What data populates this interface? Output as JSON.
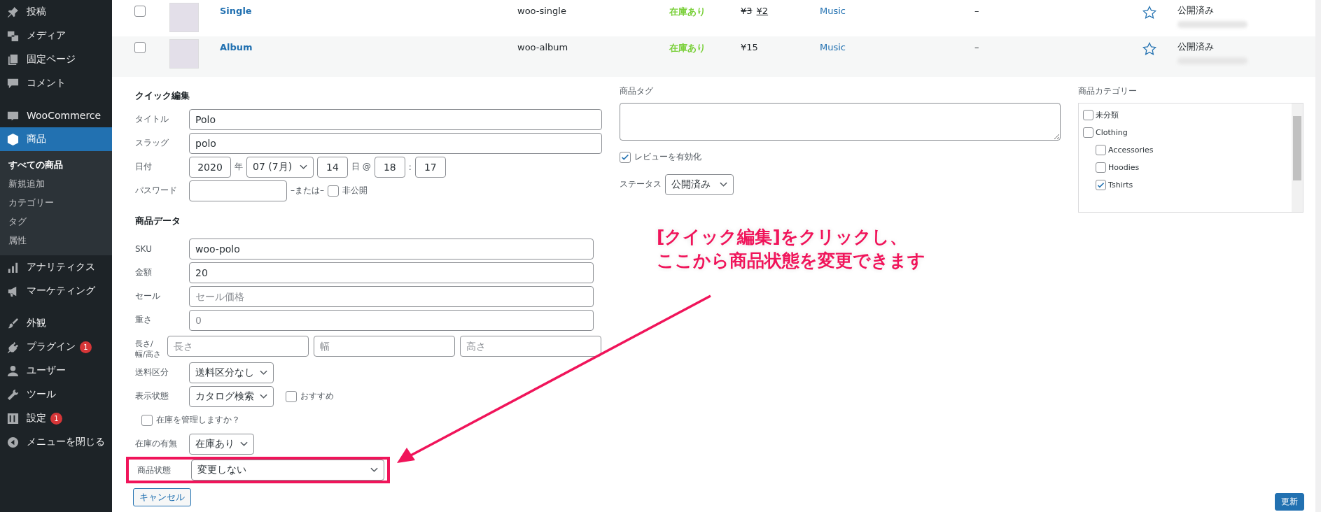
{
  "sidebar": {
    "groups": [
      {
        "items": [
          {
            "label": "投稿",
            "selected": false
          },
          {
            "label": "メディア",
            "selected": false
          },
          {
            "label": "固定ページ",
            "selected": false
          },
          {
            "label": "コメント",
            "selected": false
          }
        ]
      },
      {
        "items": [
          {
            "label": "WooCommerce",
            "selected": false
          },
          {
            "label": "商品",
            "selected": true,
            "children": [
              {
                "label": "すべての商品",
                "selected": true
              },
              {
                "label": "新規追加",
                "selected": false
              },
              {
                "label": "カテゴリー",
                "selected": false
              },
              {
                "label": "タグ",
                "selected": false
              },
              {
                "label": "属性",
                "selected": false
              }
            ]
          },
          {
            "label": "アナリティクス",
            "selected": false
          },
          {
            "label": "マーケティング",
            "selected": false
          }
        ]
      },
      {
        "items": [
          {
            "label": "外観",
            "selected": false
          },
          {
            "label": "プラグイン",
            "selected": false,
            "badge": "1"
          },
          {
            "label": "ユーザー",
            "selected": false
          },
          {
            "label": "ツール",
            "selected": false
          },
          {
            "label": "設定",
            "selected": false,
            "badge": "1"
          },
          {
            "label": "メニューを閉じる",
            "selected": false
          }
        ]
      }
    ]
  },
  "products": [
    {
      "name": "Single",
      "checked": false,
      "sku": "woo-single",
      "stock": "在庫あり",
      "price_regular": "¥3",
      "price": "¥2",
      "category": "Music",
      "tags": "–",
      "featured": false,
      "status": "公開済み"
    },
    {
      "name": "Album",
      "checked": false,
      "sku": "woo-album",
      "stock": "在庫あり",
      "price": "¥15",
      "category": "Music",
      "tags": "–",
      "featured": false,
      "status": "公開済み"
    }
  ],
  "quick_edit": {
    "title": "クイック編集",
    "fields": [
      {
        "kind": "text",
        "label": "タイトル",
        "value": "Polo"
      },
      {
        "kind": "text",
        "label": "スラッグ",
        "value": "polo"
      }
    ],
    "date": {
      "label": "日付",
      "year": "2020",
      "year_suffix": "年",
      "month": "07 (7月)",
      "day": "14",
      "day_suffix": "日 @",
      "hour": "18",
      "separator": ":",
      "minute": "17"
    },
    "password": {
      "label": "パスワード",
      "or": "–または–",
      "private_label": "非公開",
      "private_checked": false
    },
    "product_data": {
      "title": "商品データ",
      "fields": [
        {
          "kind": "text",
          "label": "SKU",
          "value": "woo-polo"
        },
        {
          "kind": "text",
          "label": "金額",
          "value": "20"
        },
        {
          "kind": "text",
          "label": "セール",
          "placeholder": "セール価格"
        },
        {
          "kind": "text",
          "label": "重さ",
          "placeholder": "0"
        },
        {
          "kind": "dimensions",
          "label": "長さ/幅/高さ",
          "placeholders": [
            "長さ",
            "幅",
            "高さ"
          ]
        },
        {
          "kind": "select",
          "label": "送料区分",
          "value": "送料区分なし"
        },
        {
          "kind": "select",
          "label": "表示状態",
          "value": "カタログ検索",
          "checkbox": {
            "label": "おすすめ",
            "checked": false
          }
        },
        {
          "kind": "checkbox",
          "label": "在庫を管理しますか？",
          "checked": false
        },
        {
          "kind": "select",
          "label": "在庫の有無",
          "value": "在庫あり"
        },
        {
          "kind": "select",
          "label": "商品状態",
          "value": "変更しない",
          "highlighted": true
        }
      ]
    },
    "tags": {
      "label": "商品タグ"
    },
    "reviews": {
      "label": "レビューを有効化",
      "checked": true
    },
    "status": {
      "label": "ステータス",
      "value": "公開済み"
    },
    "categories": {
      "label": "商品カテゴリー",
      "items": [
        {
          "label": "未分類",
          "checked": false
        },
        {
          "label": "Clothing",
          "checked": false,
          "children": [
            {
              "label": "Accessories",
              "checked": false
            },
            {
              "label": "Hoodies",
              "checked": false
            },
            {
              "label": "Tshirts",
              "checked": true
            }
          ]
        }
      ]
    },
    "cancel": "キャンセル",
    "update": "更新"
  },
  "annotation": {
    "lines": [
      "[クイック編集]をクリックし、",
      "ここから商品状態を変更できます"
    ]
  }
}
